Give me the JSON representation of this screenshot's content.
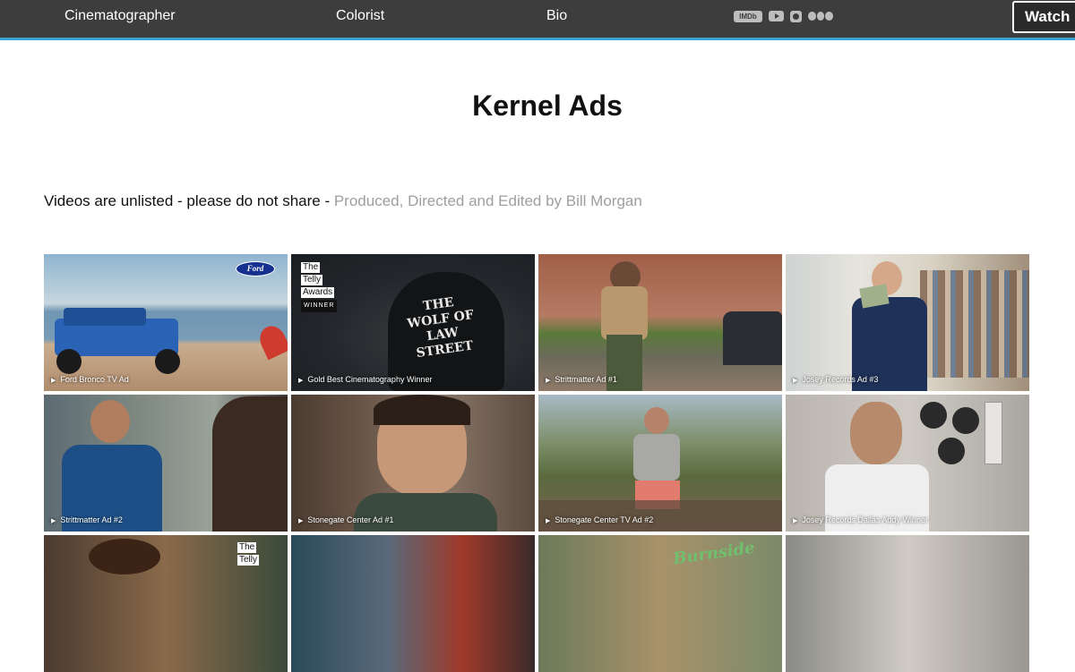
{
  "nav": {
    "links": [
      {
        "label": "Cinematographer"
      },
      {
        "label": "Colorist"
      },
      {
        "label": "Bio"
      }
    ],
    "social": {
      "imdb_label": "IMDb"
    },
    "watch_label": "Watch"
  },
  "page": {
    "title": "Kernel Ads",
    "notice": "Videos are unlisted - please do not share - ",
    "credit": "Produced, Directed and Edited by Bill Morgan"
  },
  "videos": [
    {
      "caption": "Ford Bronco TV Ad",
      "badge": "Ford"
    },
    {
      "caption": "Gold Best Cinematography Winner",
      "award": [
        "The",
        "Telly",
        "Awards",
        "WINNER"
      ],
      "overlay": "THE WOLF OF LAW STREET"
    },
    {
      "caption": "Strittmatter Ad #1"
    },
    {
      "caption": "Josey Records Ad #3"
    },
    {
      "caption": "Strittmatter Ad #2"
    },
    {
      "caption": "Stonegate Center Ad #1"
    },
    {
      "caption": "Stonegate Center TV Ad #2"
    },
    {
      "caption": "Josey Records Dallas Addy Winner"
    },
    {
      "caption": "",
      "award": [
        "The",
        "Telly"
      ]
    },
    {
      "caption": ""
    },
    {
      "caption": "",
      "overlay": "Burnside"
    },
    {
      "caption": ""
    }
  ],
  "icons": {
    "play": "play-icon",
    "imdb": "imdb-icon",
    "youtube": "youtube-icon",
    "instagram": "instagram-icon",
    "vimeo": "vimeo-icon"
  },
  "colors": {
    "topbar": "#3d3d3d",
    "accent": "#3fa3d1",
    "credit_text": "#9e9e9e"
  }
}
